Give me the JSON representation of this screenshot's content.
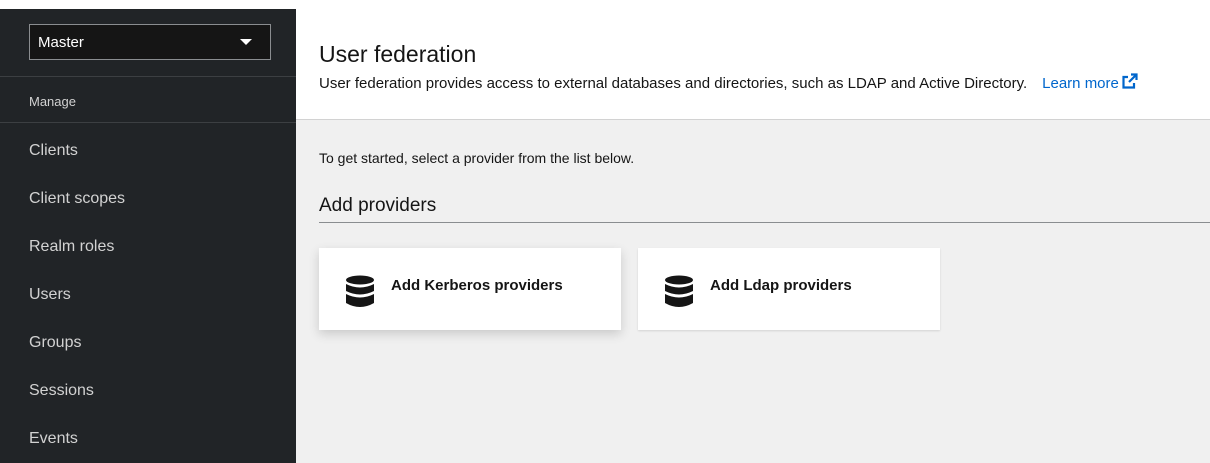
{
  "sidebar": {
    "realm": "Master",
    "section_title": "Manage",
    "items": [
      {
        "label": "Clients"
      },
      {
        "label": "Client scopes"
      },
      {
        "label": "Realm roles"
      },
      {
        "label": "Users"
      },
      {
        "label": "Groups"
      },
      {
        "label": "Sessions"
      },
      {
        "label": "Events"
      }
    ]
  },
  "header": {
    "title": "User federation",
    "description": "User federation provides access to external databases and directories, such as LDAP and Active Directory.",
    "learn_more": "Learn more"
  },
  "content": {
    "intro": "To get started, select a provider from the list below.",
    "section_title": "Add providers",
    "cards": [
      {
        "label": "Add Kerberos providers",
        "icon": "database-icon"
      },
      {
        "label": "Add Ldap providers",
        "icon": "database-icon"
      }
    ]
  },
  "colors": {
    "sidebar_bg": "#212427",
    "link": "#0066cc",
    "content_bg": "#f0f0f0"
  }
}
